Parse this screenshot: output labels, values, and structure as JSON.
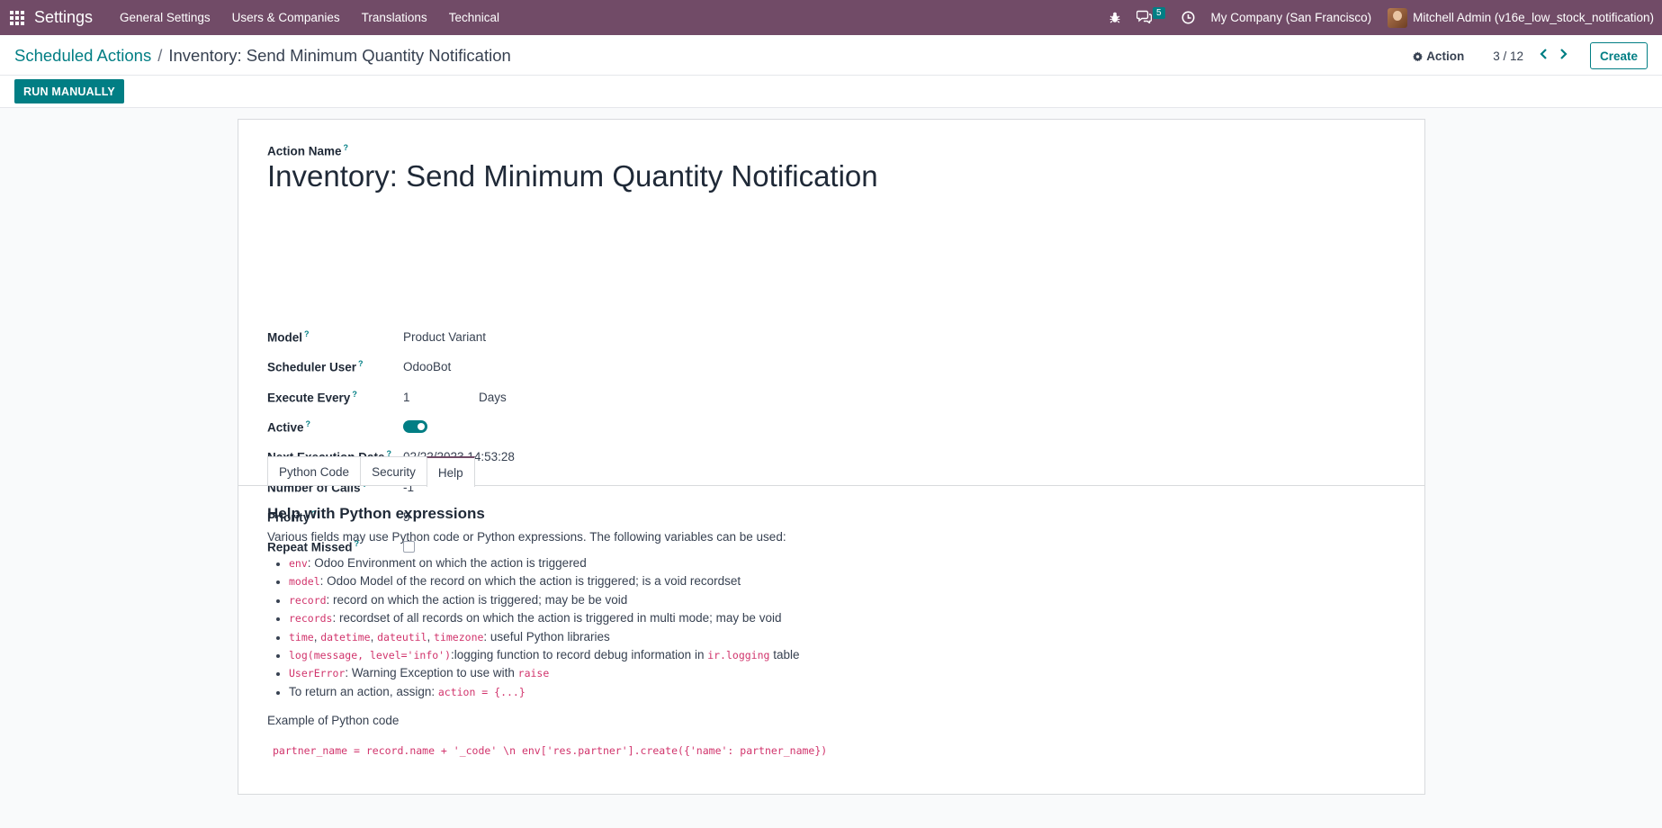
{
  "navbar": {
    "brand": "Settings",
    "menus": [
      "General Settings",
      "Users & Companies",
      "Translations",
      "Technical"
    ],
    "messages_count": "5",
    "company": "My Company (San Francisco)",
    "user": "Mitchell Admin (v16e_low_stock_notification)"
  },
  "breadcrumb": {
    "parent": "Scheduled Actions",
    "separator": "/",
    "current": "Inventory: Send Minimum Quantity Notification"
  },
  "control": {
    "action_label": "Action",
    "pager": "3 / 12",
    "create_label": "Create"
  },
  "statusbar": {
    "run_label": "RUN MANUALLY"
  },
  "form": {
    "name_label": "Action Name",
    "name_value": "Inventory: Send Minimum Quantity Notification",
    "fields": {
      "model": {
        "label": "Model",
        "value": "Product Variant"
      },
      "user": {
        "label": "Scheduler User",
        "value": "OdooBot"
      },
      "interval": {
        "label": "Execute Every",
        "value": "1",
        "unit": "Days"
      },
      "active": {
        "label": "Active",
        "value": true
      },
      "nextcall": {
        "label": "Next Execution Date",
        "value": "02/22/2023 14:53:28"
      },
      "numbercall": {
        "label": "Number of Calls",
        "value": "-1"
      },
      "priority": {
        "label": "Priority",
        "value": "5"
      },
      "doall": {
        "label": "Repeat Missed",
        "value": false
      }
    },
    "tooltip_mark": "?"
  },
  "tabs": [
    {
      "label": "Python Code",
      "active": false
    },
    {
      "label": "Security",
      "active": false
    },
    {
      "label": "Help",
      "active": true
    }
  ],
  "help": {
    "title": "Help with Python expressions",
    "intro": "Various fields may use Python code or Python expressions. The following variables can be used:",
    "items": {
      "env": {
        "code": "env",
        "text": ": Odoo Environment on which the action is triggered"
      },
      "model": {
        "code": "model",
        "text": ": Odoo Model of the record on which the action is triggered; is a void recordset"
      },
      "record": {
        "code": "record",
        "text": ": record on which the action is triggered; may be be void"
      },
      "records": {
        "code": "records",
        "text": ": recordset of all records on which the action is triggered in multi mode; may be void"
      },
      "libs": {
        "code1": "time",
        "code2": "datetime",
        "code3": "dateutil",
        "code4": "timezone",
        "sep": ", ",
        "text": ": useful Python libraries"
      },
      "log": {
        "code": "log(message, level='info')",
        "text": ":logging function to record debug information in ",
        "code2": "ir.logging",
        "text2": " table"
      },
      "usererror": {
        "code": "UserError",
        "text": ": Warning Exception to use with ",
        "code2": "raise"
      },
      "action": {
        "text": "To return an action, assign: ",
        "code": "action = {...}"
      }
    },
    "example_label": "Example of Python code",
    "example_code": "partner_name = record.name + '_code' \\n env['res.partner'].create({'name': partner_name})"
  }
}
